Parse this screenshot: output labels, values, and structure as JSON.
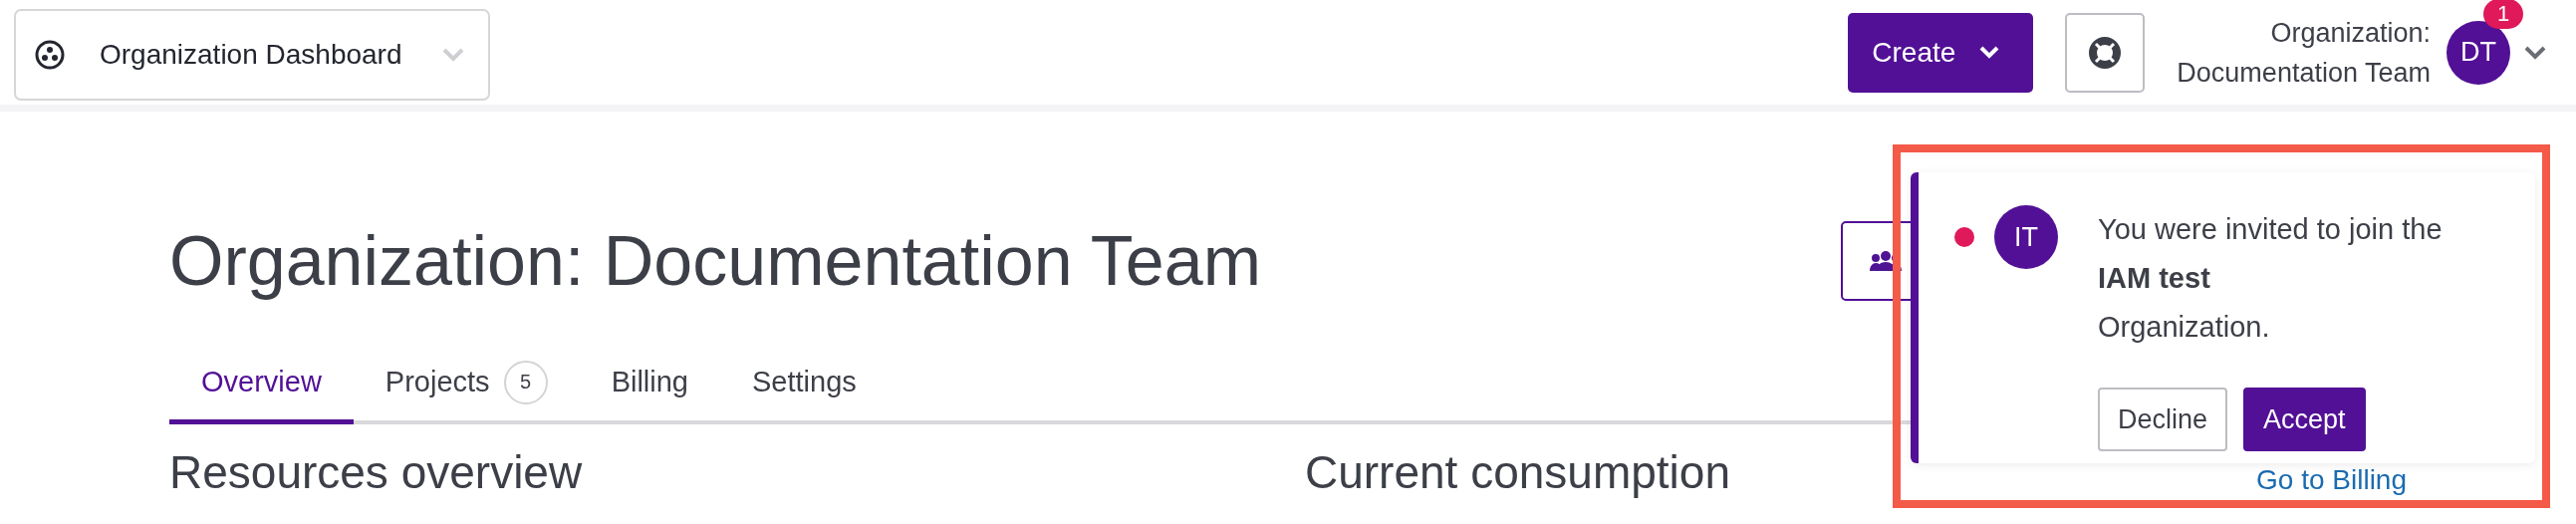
{
  "org_switcher": {
    "label": "Organization Dashboard"
  },
  "header": {
    "create_button": "Create",
    "org_label": "Organization:",
    "org_name": "Documentation Team",
    "avatar": "DT",
    "notification_count": "1"
  },
  "page": {
    "title": "Organization: Documentation Team",
    "tabs": [
      {
        "label": "Overview",
        "selected": true
      },
      {
        "label": "Projects",
        "selected": false,
        "count": "5"
      },
      {
        "label": "Billing",
        "selected": false
      },
      {
        "label": "Settings",
        "selected": false
      }
    ],
    "sections": [
      "Resources overview",
      "Current consumption"
    ],
    "billing_link": "Go to Billing"
  },
  "notification": {
    "highlighted": true,
    "unread": true,
    "avatar": "IT",
    "message": "You were invited to join the **IAM test** Organization.",
    "buttons": [
      {
        "label": "Decline",
        "kind": "secondary"
      },
      {
        "label": "Accept",
        "kind": "primary"
      }
    ]
  }
}
